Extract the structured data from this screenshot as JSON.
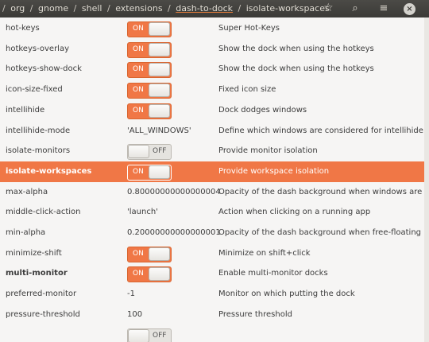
{
  "breadcrumb": [
    "/",
    "org",
    "/",
    "gnome",
    "/",
    "shell",
    "/",
    "extensions",
    "/",
    "dash-to-dock",
    "/",
    "isolate-workspaces"
  ],
  "toolbar": {
    "star_icon": "star-icon",
    "search_icon": "search-icon",
    "menu_icon": "menu-icon",
    "close_icon": "close-icon",
    "close_glyph": "×",
    "menu_glyph": "≡",
    "search_glyph": "⌕",
    "star_glyph": "☆"
  },
  "colors": {
    "accent": "#f07746",
    "titlebar": "#3c3b37"
  },
  "rows": [
    {
      "name": "hot-keys",
      "type": "toggle",
      "state": "ON",
      "description": "Super Hot-Keys"
    },
    {
      "name": "hotkeys-overlay",
      "type": "toggle",
      "state": "ON",
      "description": "Show the dock when using the hotkeys"
    },
    {
      "name": "hotkeys-show-dock",
      "type": "toggle",
      "state": "ON",
      "description": "Show the dock when using the hotkeys"
    },
    {
      "name": "icon-size-fixed",
      "type": "toggle",
      "state": "ON",
      "description": "Fixed icon size"
    },
    {
      "name": "intellihide",
      "type": "toggle",
      "state": "ON",
      "description": "Dock dodges windows"
    },
    {
      "name": "intellihide-mode",
      "type": "text",
      "value": "'ALL_WINDOWS'",
      "description": "Define which windows are considered for intellihide."
    },
    {
      "name": "isolate-monitors",
      "type": "toggle",
      "state": "OFF",
      "description": "Provide monitor isolation"
    },
    {
      "name": "isolate-workspaces",
      "type": "toggle",
      "state": "ON",
      "description": "Provide workspace isolation",
      "selected": true
    },
    {
      "name": "max-alpha",
      "type": "text",
      "value": "0.80000000000000004",
      "description": "Opacity of the dash background when windows are close."
    },
    {
      "name": "middle-click-action",
      "type": "text",
      "value": "'launch'",
      "description": "Action when clicking on a running app"
    },
    {
      "name": "min-alpha",
      "type": "text",
      "value": "0.20000000000000001",
      "description": "Opacity of the dash background when free-floating"
    },
    {
      "name": "minimize-shift",
      "type": "toggle",
      "state": "ON",
      "description": "Minimize on shift+click"
    },
    {
      "name": "multi-monitor",
      "type": "toggle",
      "state": "ON",
      "description": "Enable multi-monitor docks",
      "bold": true
    },
    {
      "name": "preferred-monitor",
      "type": "text",
      "value": "-1",
      "description": "Monitor on which putting the dock"
    },
    {
      "name": "pressure-threshold",
      "type": "text",
      "value": "100",
      "description": "Pressure threshold"
    },
    {
      "name": "",
      "type": "toggle",
      "state": "OFF",
      "description": ""
    }
  ]
}
